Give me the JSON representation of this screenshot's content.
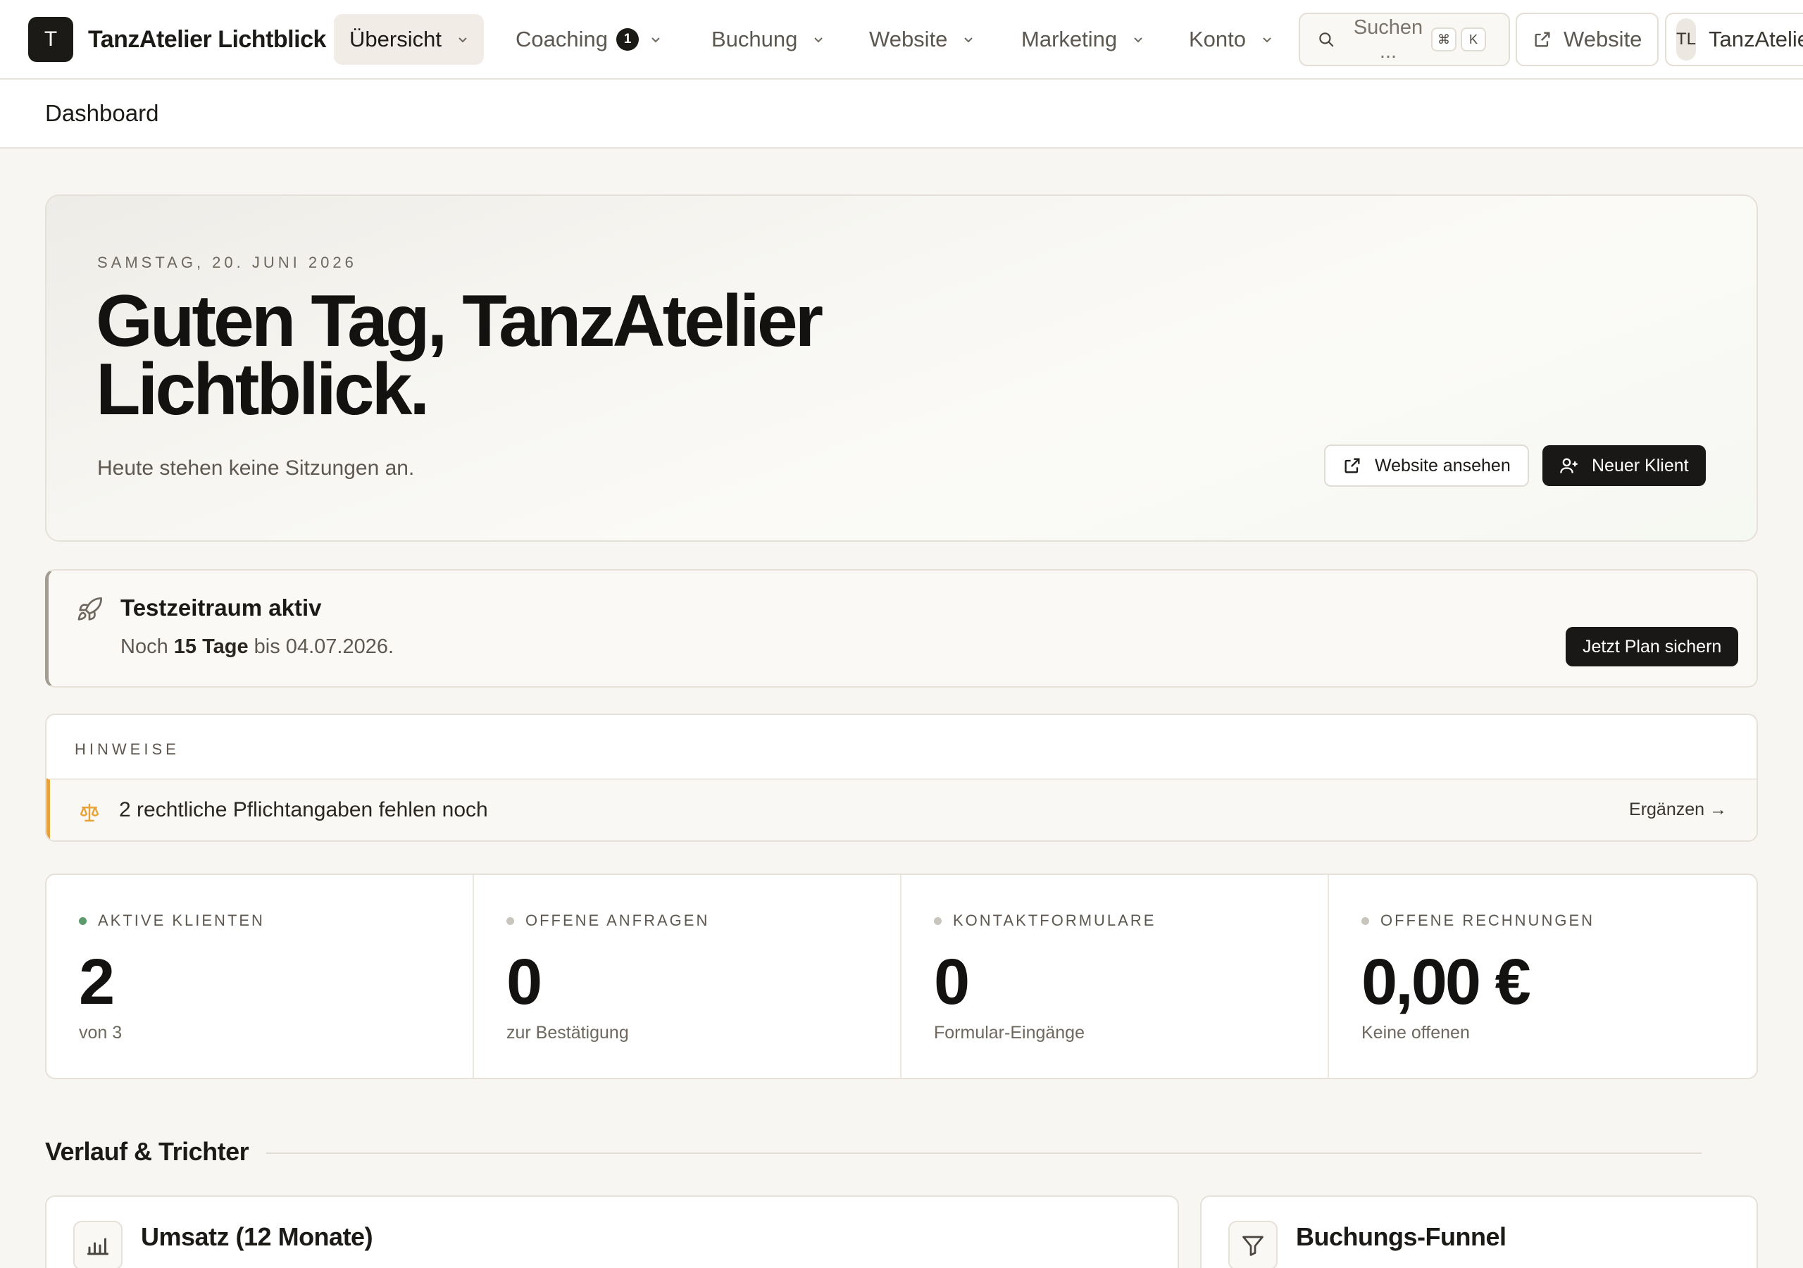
{
  "brand": {
    "logo_letter": "T",
    "name": "TanzAtelier Lichtblick"
  },
  "nav": {
    "items": [
      {
        "label": "Übersicht",
        "active": true
      },
      {
        "label": "Coaching",
        "badge": "1"
      },
      {
        "label": "Buchung"
      },
      {
        "label": "Website"
      },
      {
        "label": "Marketing"
      },
      {
        "label": "Konto"
      }
    ],
    "search": {
      "placeholder": "Suchen ...",
      "shortcut": [
        "⌘",
        "K"
      ]
    },
    "website_button": "Website",
    "user": {
      "initials": "TL",
      "name": "TanzAtelier Lichtblick"
    }
  },
  "breadcrumb": {
    "current": "Dashboard"
  },
  "hero": {
    "date": "SAMSTAG, 20. JUNI 2026",
    "greeting": "Guten Tag, TanzAtelier Lichtblick.",
    "subtitle": "Heute stehen keine Sitzungen an.",
    "btn_view_website": "Website ansehen",
    "btn_new_client": "Neuer Klient"
  },
  "trial": {
    "title": "Testzeitraum aktiv",
    "desc_prefix": "Noch ",
    "days": "15 Tage",
    "desc_suffix": " bis 04.07.2026.",
    "cta": "Jetzt Plan sichern"
  },
  "hints": {
    "heading": "HINWEISE",
    "items": [
      {
        "text": "2 rechtliche Pflichtangaben fehlen noch",
        "action": "Ergänzen →"
      }
    ],
    "accent": "#e7a23a"
  },
  "stats": [
    {
      "label": "AKTIVE KLIENTEN",
      "value": "2",
      "note": "von 3",
      "status": "green"
    },
    {
      "label": "OFFENE ANFRAGEN",
      "value": "0",
      "note": "zur Bestätigung",
      "status": "grey"
    },
    {
      "label": "KONTAKTFORMULARE",
      "value": "0",
      "note": "Formular-Eingänge",
      "status": "grey"
    },
    {
      "label": "OFFENE RECHNUNGEN",
      "value": "0,00 €",
      "note": "Keine offenen",
      "status": "grey"
    }
  ],
  "section": {
    "title": "Verlauf & Trichter"
  },
  "cards": [
    {
      "title": "Umsatz (12 Monate)",
      "icon": "bar-chart-icon"
    },
    {
      "title": "Buchungs-Funnel",
      "icon": "funnel-icon"
    }
  ]
}
